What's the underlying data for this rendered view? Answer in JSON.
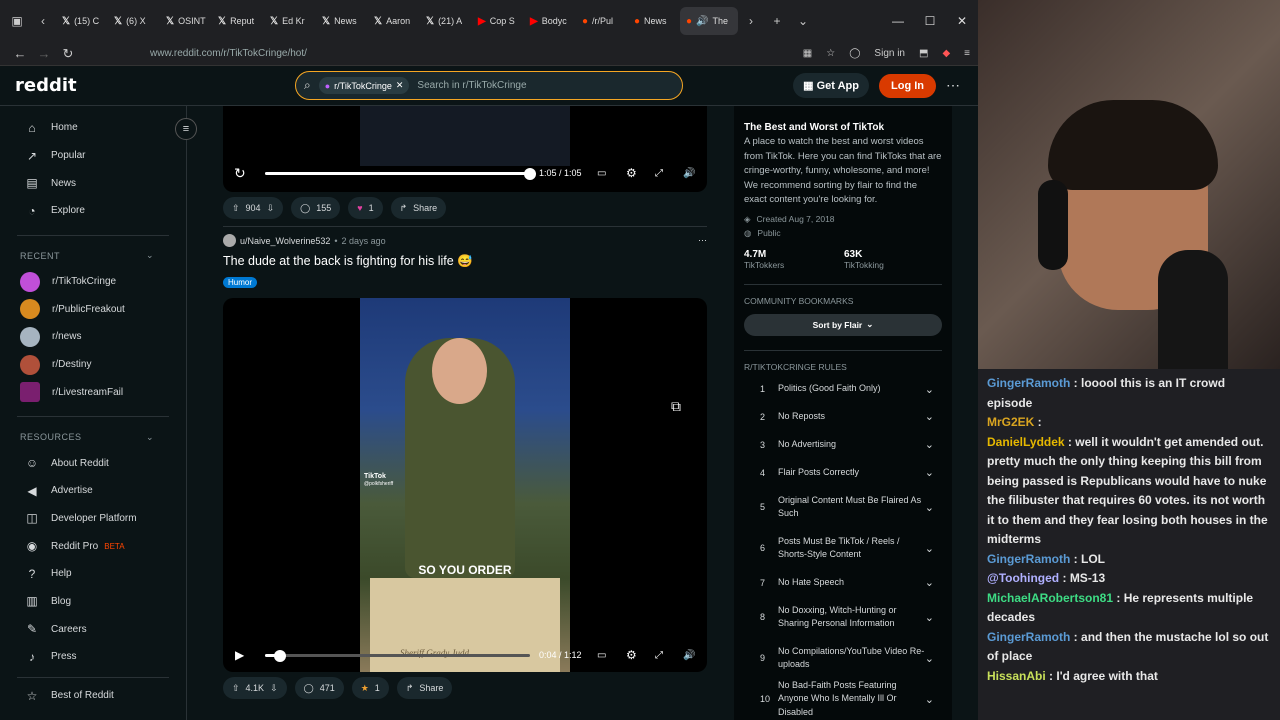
{
  "browser": {
    "tabs": [
      "(15) C",
      "(6) X",
      "OSINT",
      "Reput",
      "Ed Kr",
      "News",
      "Aaron",
      "(21) A",
      "Cop S",
      "Bodyc",
      "/r/Pul",
      "News",
      "The"
    ],
    "url": "www.reddit.com/r/TikTokCringe/hot/",
    "signin": "Sign in"
  },
  "header": {
    "logo": "reddit",
    "chip": "r/TikTokCringe",
    "search_placeholder": "Search in r/TikTokCringe",
    "getapp": "Get App",
    "login": "Log In"
  },
  "sidebar": {
    "main": [
      "Home",
      "Popular",
      "News",
      "Explore"
    ],
    "recent_title": "RECENT",
    "recent": [
      "r/TikTokCringe",
      "r/PublicFreakout",
      "r/news",
      "r/Destiny",
      "r/LivestreamFail"
    ],
    "resources_title": "RESOURCES",
    "resources": [
      "About Reddit",
      "Advertise",
      "Developer Platform",
      "Reddit Pro",
      "Help",
      "Blog",
      "Careers",
      "Press"
    ],
    "beta": "BETA",
    "best": "Best of Reddit"
  },
  "post1": {
    "time": "1:05 / 1:05",
    "progress": 1.0,
    "votes": "904",
    "comments": "155",
    "awards": "1",
    "share": "Share"
  },
  "post2": {
    "author": "u/Naive_Wolverine532",
    "age": "2 days ago",
    "title": "The dude at the back is fighting for his life 😅",
    "flair": "Humor",
    "caption": "SO YOU ORDER",
    "tiktok": "TikTok",
    "handle": "@polkfsheriff",
    "podium": "Sheriff Grady Judd",
    "time": "0:04 / 1:12",
    "progress": 0.056,
    "votes": "4.1K",
    "comments": "471",
    "awards": "1",
    "share": "Share"
  },
  "community": {
    "title": "The Best and Worst of TikTok",
    "desc": "A place to watch the best and worst videos from TikTok. Here you can find TikToks that are cringe-worthy, funny, wholesome, and more! We recommend sorting by flair to find the exact content you're looking for.",
    "created": "Created Aug 7, 2018",
    "public": "Public",
    "members": "4.7M",
    "members_label": "TikTokkers",
    "online": "63K",
    "online_label": "TikTokking",
    "bookmarks_title": "COMMUNITY BOOKMARKS",
    "sort": "Sort by Flair",
    "rules_title": "R/TIKTOKCRINGE RULES",
    "rules": [
      "Politics (Good Faith Only)",
      "No Reposts",
      "No Advertising",
      "Flair Posts Correctly",
      "Original Content Must Be Flaired As Such",
      "Posts Must Be TikTok / Reels / Shorts-Style Content",
      "No Hate Speech",
      "No Doxxing, Witch-Hunting or Sharing Personal Information",
      "No Compilations/YouTube Video Re-uploads",
      "No Bad-Faith Posts Featuring Anyone Who Is Mentally Ill Or Disabled"
    ]
  },
  "chat": [
    {
      "user": "GingerRamoth",
      "color": "#5b9bd5",
      "msg": "looool this is an IT crowd episode"
    },
    {
      "user": "MrG2EK",
      "color": "#daa520",
      "msg": ""
    },
    {
      "user": "DanielLyddek",
      "color": "#e6b800",
      "msg": "well it wouldn't get amended out. pretty much the only thing keeping this bill from being passed is Republicans would have to nuke the filibuster that requires 60 votes. its not worth it to them and they fear losing both houses in the midterms"
    },
    {
      "user": "GingerRamoth",
      "color": "#5b9bd5",
      "msg": "LOL"
    },
    {
      "user": "@Toohinged",
      "color": "#b0b0ff",
      "msg": "MS-13"
    },
    {
      "user": "MichaelARobertson81",
      "color": "#3ddc84",
      "msg": "He represents multiple decades"
    },
    {
      "user": "GingerRamoth",
      "color": "#5b9bd5",
      "msg": "and then the mustache lol so out of place"
    },
    {
      "user": "HissanAbi",
      "color": "#c8e05a",
      "msg": "I'd agree with that"
    }
  ]
}
